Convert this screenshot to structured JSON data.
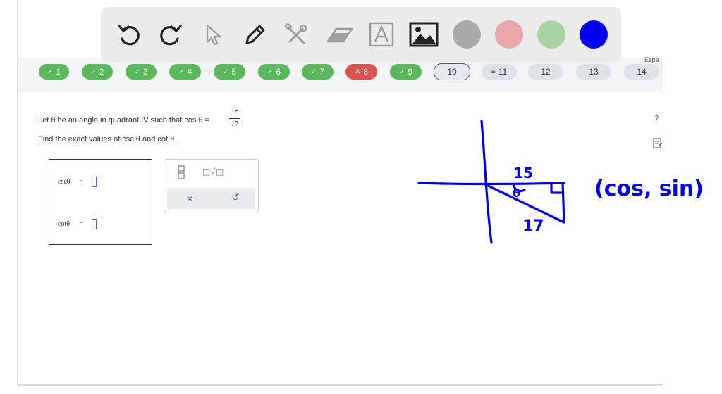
{
  "toolbar": {
    "tools": [
      "undo-icon",
      "redo-icon",
      "pointer-icon",
      "pen-icon",
      "tools-icon",
      "eraser-icon",
      "text-icon",
      "image-icon"
    ],
    "colors": [
      "#a9a9a9",
      "#e8a7ab",
      "#a9d3a5",
      "#0000ee"
    ]
  },
  "question_nav": [
    {
      "label": "1",
      "status": "correct"
    },
    {
      "label": "2",
      "status": "correct"
    },
    {
      "label": "3",
      "status": "correct"
    },
    {
      "label": "4",
      "status": "correct"
    },
    {
      "label": "5",
      "status": "correct"
    },
    {
      "label": "6",
      "status": "correct"
    },
    {
      "label": "7",
      "status": "correct"
    },
    {
      "label": "8",
      "status": "incorrect"
    },
    {
      "label": "9",
      "status": "correct"
    },
    {
      "label": "10",
      "status": "current"
    },
    {
      "label": "11",
      "status": "partial"
    },
    {
      "label": "12",
      "status": "unanswered"
    },
    {
      "label": "13",
      "status": "unanswered"
    },
    {
      "label": "14",
      "status": "unanswered"
    }
  ],
  "nav_marks": {
    "correct": "✓",
    "incorrect": "✕",
    "partial": "≡"
  },
  "language_tag": "Espa",
  "question": {
    "line1_prefix": "Let θ be an angle in quadrant IV such that cos θ =",
    "frac_num": "15",
    "frac_den": "17",
    "line1_suffix": ".",
    "line2": "Find the exact values of csc θ and cot θ."
  },
  "answers": [
    {
      "label": "cscθ",
      "equals": "=",
      "value": ""
    },
    {
      "label": "cotθ",
      "equals": "=",
      "value": ""
    }
  ],
  "keypad": {
    "fraction_key": "fraction-icon",
    "sqrt_key": "□√□",
    "clear_key": "×",
    "undo_key": "↺"
  },
  "side_icons": {
    "help": "?",
    "notes": "notes-icon"
  },
  "sketch": {
    "ink_color": "#0000ee",
    "text_15": "15",
    "text_17": "17",
    "text_theta": "θ",
    "text_note": "(cos, sin)"
  }
}
